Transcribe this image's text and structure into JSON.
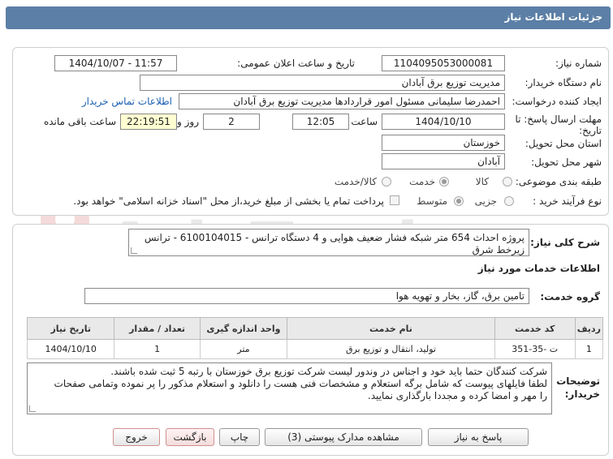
{
  "page_title": "جزئیات اطلاعات نیاز",
  "fields": {
    "need_number_label": "شماره نیاز:",
    "need_number": "1104095053000081",
    "announce_datetime_label": "تاریخ و ساعت اعلان عمومی:",
    "announce_datetime": "1404/10/07 - 11:57",
    "buyer_org_label": "نام دستگاه خریدار:",
    "buyer_org": "مدیریت توزیع برق آبادان",
    "creator_label": "ایجاد کننده درخواست:",
    "creator": "احمدرضا سلیمانی مسئول امور قراردادها مدیریت توزیع برق آبادان",
    "buyer_contact_link": "اطلاعات تماس خریدار",
    "deadline_label": "مهلت ارسال پاسخ: تا تاریخ:",
    "deadline_date": "1404/10/10",
    "time_label": "ساعت",
    "deadline_time": "12:05",
    "days_count": "2",
    "days_and_label": "روز و",
    "remaining_time": "22:19:51",
    "remaining_label": "ساعت باقی مانده",
    "province_label": "استان محل تحویل:",
    "province": "خوزستان",
    "city_label": "شهر محل تحویل:",
    "city": "آبادان",
    "category_label": "طبقه بندی موضوعی:",
    "category_options": [
      "کالا",
      "خدمت",
      "کالا/خدمت"
    ],
    "process_label": "نوع فرآیند خرید :",
    "process_options": [
      "جزیی",
      "متوسط"
    ],
    "payment_note": "پرداخت تمام یا بخشی از مبلغ خرید،از محل \"اسناد خزانه اسلامی\" خواهد بود."
  },
  "summary": {
    "label": "شرح کلی نیاز:",
    "text": "پروژه احداث 654 متر شبکه فشار ضعیف هوایی و 4 دستگاه ترانس - 6100104015 - ترانس زیرخط شرق"
  },
  "services": {
    "section_title": "اطلاعات خدمات مورد نیاز",
    "group_label": "گروه خدمت:",
    "group_value": "تامین برق، گاز، بخار و تهویه هوا",
    "columns": [
      "ردیف",
      "کد خدمت",
      "نام خدمت",
      "واحد اندازه گیری",
      "تعداد / مقدار",
      "تاریخ نیاز"
    ],
    "rows": [
      [
        "1",
        "ت -35-351",
        "تولید، انتقال و توزیع برق",
        "متر",
        "1",
        "1404/10/10"
      ]
    ]
  },
  "buyer_notes": {
    "label": "توضیحات خریدار:",
    "lines": [
      "شرکت کنندگان حتما باید خود و اجناس در وندور لیست شرکت توزیع برق خوزستان با رتبه 5 ثبت شده باشند.",
      "لطفا فایلهای پیوست که شامل برگه استعلام و مشخصات فنی هست را دانلود و استعلام مذکور را پر نموده وتمامی صفحات",
      "را مهر و امضا کرده و مجددا بارگذاری نمایید."
    ]
  },
  "buttons": {
    "reply": "پاسخ به نیاز",
    "view_attachments": "مشاهده مدارک پیوستی (3)",
    "print": "چاپ",
    "back": "بازگشت",
    "exit": "خروج"
  },
  "watermark_text": "AriaTender.net",
  "colors": {
    "header_bar": "#5b7fa6",
    "link": "#1a5fb4",
    "remaining_bg": "#ffffd2"
  }
}
